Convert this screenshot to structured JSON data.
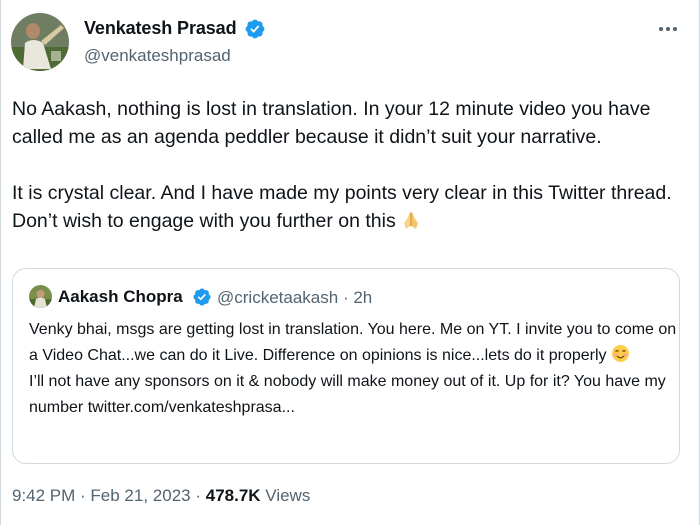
{
  "tweet": {
    "author": {
      "name": "Venkatesh Prasad",
      "handle": "@venkateshprasad",
      "avatar": "profile-photo-cricketer",
      "verified_icon": "verified-badge-icon"
    },
    "more_icon": "more-options-icon",
    "paragraph_1": "No Aakash, nothing is lost in translation. In your 12 minute video you have called me as an agenda peddler because it didn’t suit your narrative.",
    "paragraph_2": "It is crystal clear. And I have made my points very clear in this Twitter thread. Don’t wish to engage with you further on this",
    "paragraph_2_emoji": "folded-hands-emoji",
    "timestamp": "9:42 PM · Feb 21, 2023 ·",
    "views_count": "478.7K",
    "views_label": "Views"
  },
  "quoted_tweet": {
    "author": {
      "name": "Aakash Chopra",
      "handle": "@cricketaakash",
      "separator": "·",
      "time_ago": "2h",
      "avatar": "profile-photo",
      "verified_icon": "verified-badge-icon"
    },
    "text_1": "Venky bhai, msgs are getting lost in translation. You here. Me on YT. I invite you to come on a Video Chat...we can do it Live. Difference on opinions is nice...lets do it properly",
    "text_1_emoji": "smiling-face-emoji",
    "text_2": "I’ll not have any sponsors on it & nobody will make money out of it. Up for it? You have my number twitter.com/venkateshprasa..."
  },
  "colors": {
    "text_primary": "#0f1419",
    "text_secondary": "#536471",
    "verified_blue": "#1d9bf0",
    "border": "#cfd9de"
  }
}
